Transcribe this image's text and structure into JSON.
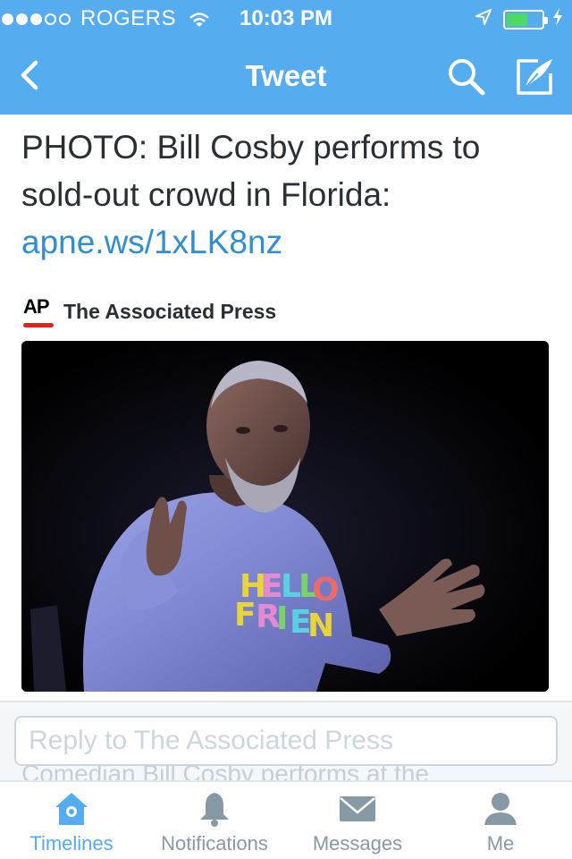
{
  "status_bar": {
    "carrier": "ROGERS",
    "time": "10:03 PM",
    "signal_filled": 3,
    "signal_total": 5,
    "battery_level": 0.6
  },
  "nav": {
    "title": "Tweet",
    "back_icon": "chevron-left-icon",
    "search_icon": "search-icon",
    "compose_icon": "compose-icon"
  },
  "tweet": {
    "text": "PHOTO: Bill Cosby performs to sold-out crowd in Florida:",
    "link": "apne.ws/1xLK8nz",
    "author": {
      "logo_text": "AP",
      "name": "The Associated Press"
    },
    "photo_caption_ghost": "Comedian Bill Cosby performs at the"
  },
  "reply": {
    "placeholder": "Reply to The Associated Press"
  },
  "tabs": [
    {
      "label": "Timelines",
      "icon": "home-icon",
      "active": true
    },
    {
      "label": "Notifications",
      "icon": "bell-icon",
      "active": false
    },
    {
      "label": "Messages",
      "icon": "envelope-icon",
      "active": false
    },
    {
      "label": "Me",
      "icon": "person-icon",
      "active": false
    }
  ],
  "colors": {
    "twitter_blue": "#55acee",
    "link_blue": "#2f8fd1",
    "battery_green": "#4cd964",
    "ap_red": "#e2231a"
  }
}
